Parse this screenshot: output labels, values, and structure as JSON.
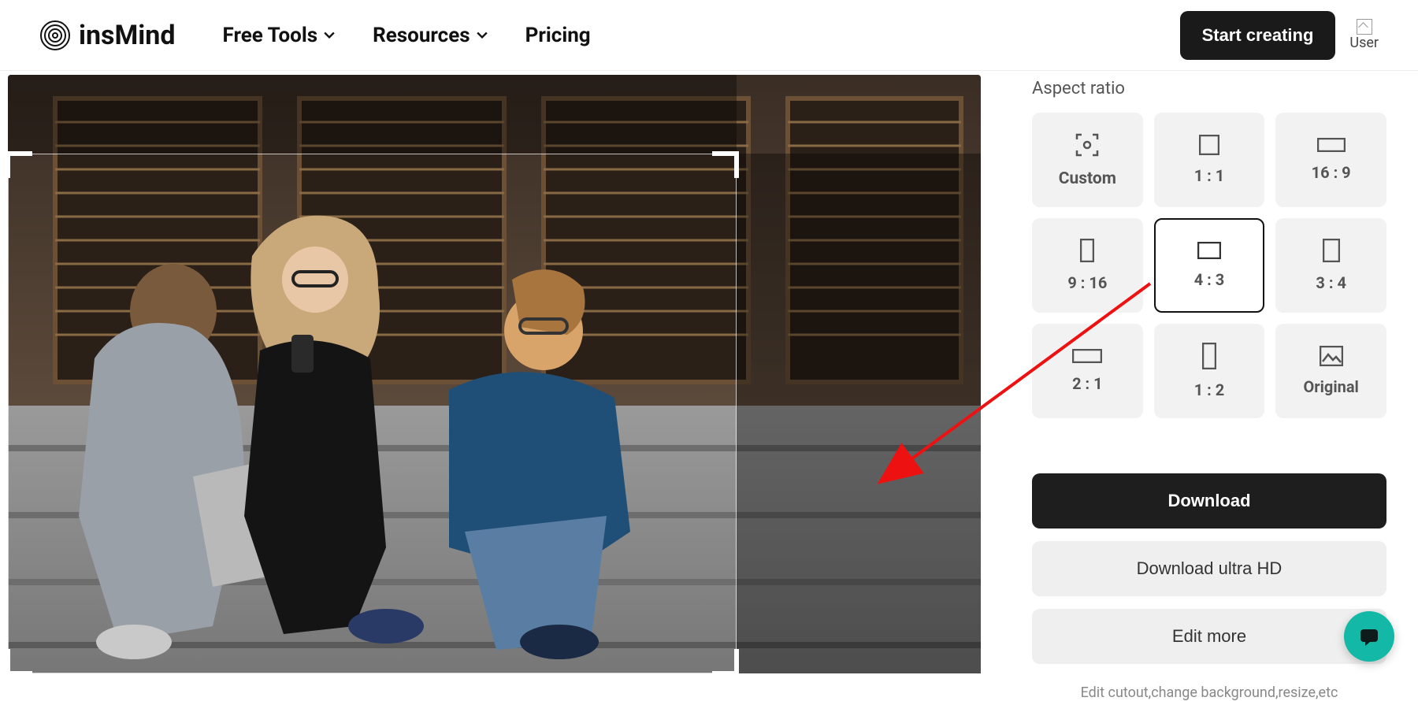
{
  "header": {
    "brand": "insMind",
    "nav": {
      "free_tools": "Free Tools",
      "resources": "Resources",
      "pricing": "Pricing"
    },
    "cta": "Start creating",
    "user_label": "User"
  },
  "sidebar": {
    "section_label": "Aspect ratio",
    "ratios": [
      {
        "key": "custom",
        "label": "Custom",
        "icon": "crop-target",
        "active": false
      },
      {
        "key": "1-1",
        "label": "1 : 1",
        "icon": "square",
        "active": false
      },
      {
        "key": "16-9",
        "label": "16 : 9",
        "icon": "wide",
        "active": false
      },
      {
        "key": "9-16",
        "label": "9 : 16",
        "icon": "tall",
        "active": false
      },
      {
        "key": "4-3",
        "label": "4 : 3",
        "icon": "landscape",
        "active": true
      },
      {
        "key": "3-4",
        "label": "3 : 4",
        "icon": "portrait",
        "active": false
      },
      {
        "key": "2-1",
        "label": "2 : 1",
        "icon": "wide",
        "active": false
      },
      {
        "key": "1-2",
        "label": "1 : 2",
        "icon": "tall",
        "active": false
      },
      {
        "key": "original",
        "label": "Original",
        "icon": "image",
        "active": false
      }
    ],
    "actions": {
      "download": "Download",
      "download_hd": "Download ultra HD",
      "edit_more": "Edit more",
      "hint": "Edit cutout,change background,resize,etc"
    }
  },
  "canvas": {
    "image_alt": "Three people sitting on steps with a laptop and phone"
  }
}
